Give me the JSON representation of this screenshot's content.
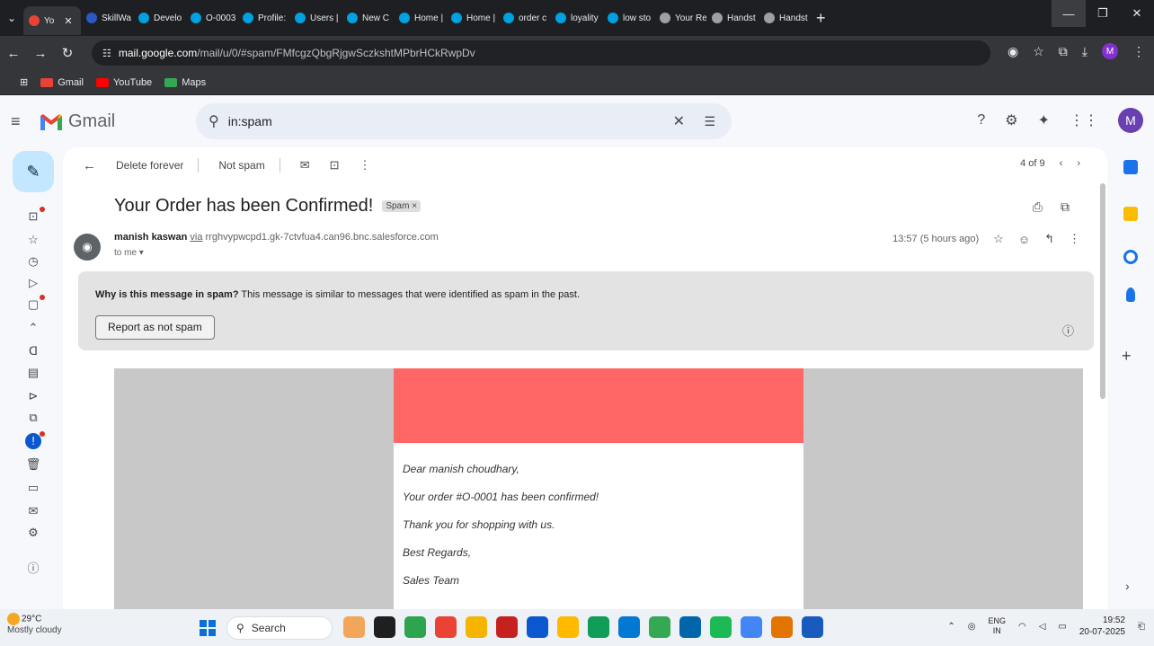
{
  "browser": {
    "tabs": [
      {
        "label": "Yo",
        "color": "#ea4335",
        "active": true
      },
      {
        "label": "SkillWa",
        "color": "#2b59c3"
      },
      {
        "label": "Develo",
        "color": "#00a1e0"
      },
      {
        "label": "O-0003",
        "color": "#00a1e0"
      },
      {
        "label": "Profile:",
        "color": "#00a1e0"
      },
      {
        "label": "Users |",
        "color": "#00a1e0"
      },
      {
        "label": "New C",
        "color": "#00a1e0"
      },
      {
        "label": "Home |",
        "color": "#00a1e0"
      },
      {
        "label": "Home |",
        "color": "#00a1e0"
      },
      {
        "label": "order c",
        "color": "#00a1e0"
      },
      {
        "label": "loyality",
        "color": "#00a1e0"
      },
      {
        "label": "low sto",
        "color": "#00a1e0"
      },
      {
        "label": "Your Re",
        "color": "#9aa0a6"
      },
      {
        "label": "Handst",
        "color": "#9aa0a6"
      },
      {
        "label": "Handst",
        "color": "#9aa0a6"
      }
    ],
    "url_host": "mail.google.com",
    "url_path": "/mail/u/0/#spam/FMfcgzQbgRjgwSczkshtMPbrHCkRwpDv",
    "profile_initial": "M",
    "bookmarks": [
      {
        "label": "Gmail",
        "color": "#ea4335"
      },
      {
        "label": "YouTube",
        "color": "#ff0000"
      },
      {
        "label": "Maps",
        "color": "#34a853"
      }
    ]
  },
  "gmail": {
    "logo_text": "Gmail",
    "search_value": "in:spam",
    "avatar_initial": "M",
    "toolbar": {
      "delete_forever": "Delete forever",
      "not_spam": "Not spam",
      "pager": "4 of 9"
    },
    "email": {
      "subject": "Your Order has been Confirmed!",
      "label": "Spam ×",
      "sender_name": "manish kaswan",
      "via_word": "via",
      "via_host": "rrghvypwcpd1.gk-7ctvfua4.can96.bnc.salesforce.com",
      "to": "to me ▾",
      "time": "13:57 (5 hours ago)"
    },
    "spam_banner": {
      "question": "Why is this message in spam?",
      "explanation": "This message is similar to messages that were identified as spam in the past.",
      "button": "Report as not spam"
    },
    "body_lines": [
      "Dear manish choudhary,",
      "Your order #O-0001 has been confirmed!",
      "Thank you for shopping with us.",
      "Best Regards,",
      "Sales Team"
    ],
    "banner_color": "#ff6666"
  },
  "taskbar": {
    "temp": "29°C",
    "weather": "Mostly cloudy",
    "search": "Search",
    "lang_1": "ENG",
    "lang_2": "IN",
    "time": "19:52",
    "date": "20-07-2025",
    "apps": [
      "#f2a65a",
      "#1f1f1f",
      "#2ea44f",
      "#ea4335",
      "#f4b400",
      "#c5221f",
      "#0b57d0",
      "#ffb900",
      "#0f9d58",
      "#0078d4",
      "#34a853",
      "#0065a9",
      "#1db954",
      "#4285f4",
      "#e37400",
      "#185abd"
    ]
  }
}
